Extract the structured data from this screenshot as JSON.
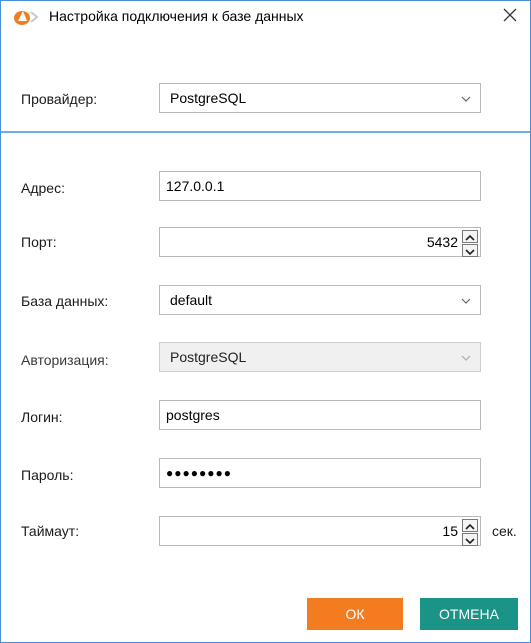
{
  "window": {
    "title": "Настройка подключения к базе данных",
    "colors": {
      "accent": "#f47c20",
      "secondary": "#1a9486",
      "divider": "#6aaee6"
    }
  },
  "provider": {
    "label": "Провайдер:",
    "value": "PostgreSQL"
  },
  "address": {
    "label": "Адрес:",
    "value": "127.0.0.1"
  },
  "port": {
    "label": "Порт:",
    "value": "5432"
  },
  "database": {
    "label": "База данных:",
    "value": "default"
  },
  "auth": {
    "label": "Авторизация:",
    "value": "PostgreSQL"
  },
  "login": {
    "label": "Логин:",
    "value": "postgres"
  },
  "password": {
    "label": "Пароль:",
    "value": "●●●●●●●●"
  },
  "timeout": {
    "label": "Таймаут:",
    "value": "15",
    "unit": "сек."
  },
  "buttons": {
    "ok": "ОК",
    "cancel": "ОТМЕНА"
  },
  "icons": {
    "app": "app-logo-icon",
    "close": "close-icon",
    "chevron": "chevron-down-icon",
    "spin_up": "arrow-up-icon",
    "spin_down": "arrow-down-icon"
  }
}
